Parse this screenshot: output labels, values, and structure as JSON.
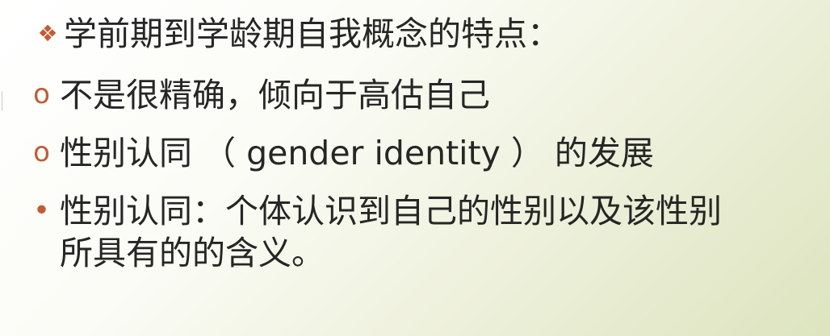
{
  "slide": {
    "lines": [
      {
        "bullet": "❖",
        "text": "学前期到学龄期自我概念的特点："
      },
      {
        "bullet": "o",
        "text": "不是很精确，倾向于高估自己"
      },
      {
        "bullet": "o",
        "text": "性别认同 （ gender identity ） 的发展"
      },
      {
        "bullet": "•",
        "text": "性别认同：个体认识到自己的性别以及该性别"
      },
      {
        "text": "所具有的的含义。"
      }
    ]
  }
}
